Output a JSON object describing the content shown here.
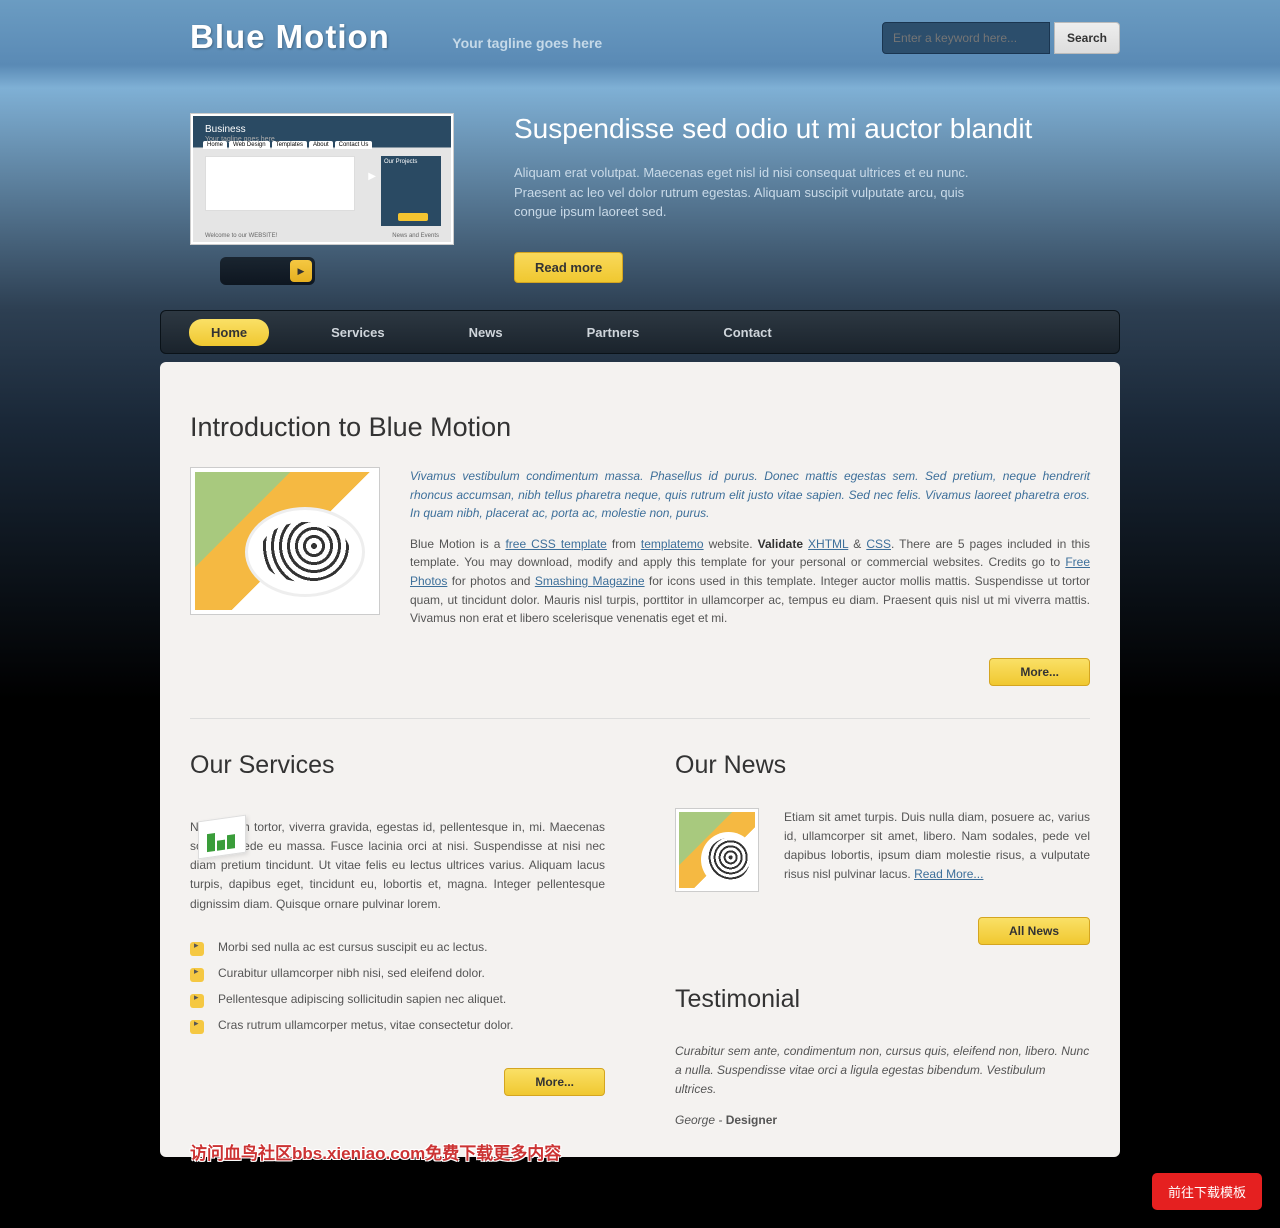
{
  "header": {
    "logo": "Blue Motion",
    "tagline": "Your tagline goes here",
    "search_placeholder": "Enter a keyword here...",
    "search_btn": "Search"
  },
  "hero": {
    "thumb": {
      "title": "Business",
      "subtitle": "Your tagline goes here",
      "tabs": [
        "Home",
        "Web Design",
        "Templates",
        "About",
        "Contact Us"
      ],
      "box2_title": "Our Projects",
      "footer_left": "Welcome to our WEBSITE!",
      "footer_right": "News and Events"
    },
    "title": "Suspendisse sed odio ut mi auctor blandit",
    "body": "Aliquam erat volutpat. Maecenas eget nisl id nisi consequat ultrices et eu nunc. Praesent ac leo vel dolor rutrum egestas. Aliquam suscipit vulputate arcu, quis congue ipsum laoreet sed.",
    "button": "Read more"
  },
  "nav": [
    "Home",
    "Services",
    "News",
    "Partners",
    "Contact"
  ],
  "intro": {
    "heading": "Introduction to Blue Motion",
    "lead": "Vivamus vestibulum condimentum massa. Phasellus id purus. Donec mattis egestas sem. Sed pretium, neque hendrerit rhoncus accumsan, nibh tellus pharetra neque, quis rutrum elit justo vitae sapien. Sed nec felis. Vivamus laoreet pharetra eros. In quam nibh, placerat ac, porta ac, molestie non, purus.",
    "p2_a": "Blue Motion is a ",
    "link1": "free CSS template",
    "p2_b": " from ",
    "link2": "templatemo",
    "p2_c": " website. ",
    "bold1": "Validate ",
    "link3": "XHTML",
    "amp": " & ",
    "link4": "CSS",
    "p2_d": ". There are 5 pages included in this template. You may download, modify and apply this template for your personal or commercial websites. Credits go to ",
    "link5": "Free Photos",
    "p2_e": " for photos and ",
    "link6": "Smashing Magazine",
    "p2_f": " for icons used in this template. Integer auctor mollis mattis. Suspendisse ut tortor quam, ut tincidunt dolor. Mauris nisl turpis, porttitor in ullamcorper ac, tempus eu diam. Praesent quis nisl ut mi viverra mattis. Vivamus non erat et libero scelerisque venenatis eget et mi.",
    "more_btn": "More..."
  },
  "services": {
    "heading": "Our Services",
    "body": "Nam lorem tortor, viverra gravida, egestas id, pellentesque in, mi. Maecenas sodales pede eu massa. Fusce lacinia orci at nisi. Suspendisse at nisi nec diam pretium tincidunt. Ut vitae felis eu lectus ultrices varius. Aliquam lacus turpis, dapibus eget, tincidunt eu, lobortis et, magna. Integer pellentesque dignissim diam. Quisque ornare pulvinar lorem.",
    "bullets": [
      "Morbi sed nulla ac est cursus suscipit eu ac lectus.",
      "Curabitur ullamcorper nibh nisi, sed eleifend dolor.",
      "Pellentesque adipiscing sollicitudin sapien nec aliquet.",
      "Cras rutrum ullamcorper metus, vitae consectetur dolor."
    ],
    "more_btn": "More..."
  },
  "news": {
    "heading": "Our News",
    "body": "Etiam sit amet turpis. Duis nulla diam, posuere ac, varius id, ullamcorper sit amet, libero. Nam sodales, pede vel dapibus lobortis, ipsum diam molestie risus, a vulputate risus nisl pulvinar lacus. ",
    "link": "Read More...",
    "all_btn": "All News"
  },
  "testimonial": {
    "heading": "Testimonial",
    "quote": "Curabitur sem ante, condimentum non, cursus quis, eleifend non, libero. Nunc a nulla. Suspendisse vitae orci a ligula egestas bibendum. Vestibulum ultrices.",
    "author": "George - ",
    "role": "Designer"
  },
  "banner": "访问血鸟社区bbs.xieniao.com免费下载更多内容",
  "download": "前往下载模板"
}
